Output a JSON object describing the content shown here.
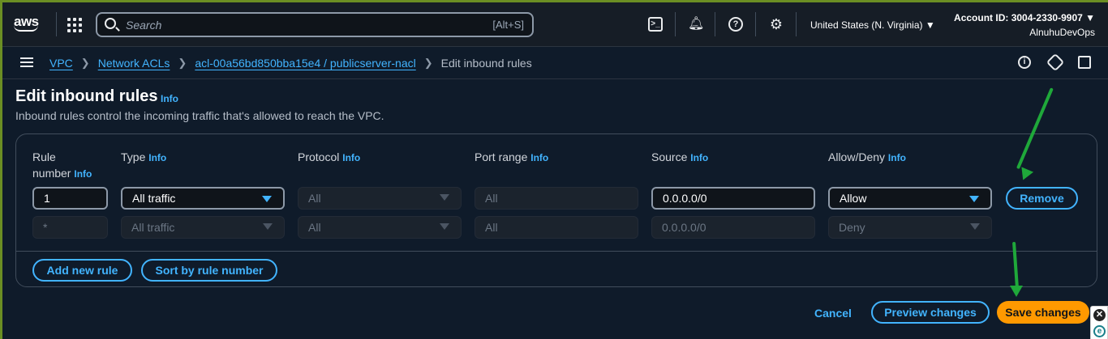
{
  "topnav": {
    "logo": "aws",
    "search_placeholder": "Search",
    "search_shortcut": "[Alt+S]",
    "region": "United States (N. Virginia) ▼",
    "account_id": "Account ID: 3004-2330-9907 ▼",
    "account_name": "AlnuhuDevOps",
    "icons": [
      "services-grid-icon",
      "search-icon",
      "cloudshell-icon",
      "notifications-bell-icon",
      "help-icon",
      "settings-gear-icon"
    ]
  },
  "breadcrumb": {
    "items": [
      "VPC",
      "Network ACLs",
      "acl-00a56bd850bba15e4 / publicserver-nacl"
    ],
    "current": "Edit inbound rules"
  },
  "page": {
    "title": "Edit inbound rules",
    "info": "Info",
    "description": "Inbound rules control the incoming traffic that's allowed to reach the VPC."
  },
  "table": {
    "headers": {
      "rule_number_line1": "Rule",
      "rule_number_line2": "number",
      "type": "Type",
      "protocol": "Protocol",
      "port_range": "Port range",
      "source": "Source",
      "allow_deny": "Allow/Deny",
      "info": "Info"
    },
    "rows": [
      {
        "rule_number": "1",
        "type": "All traffic",
        "protocol": "All",
        "port_range": "All",
        "source": "0.0.0.0/0",
        "allow_deny": "Allow",
        "action": "Remove"
      },
      {
        "rule_number": "*",
        "type": "All traffic",
        "protocol": "All",
        "port_range": "All",
        "source": "0.0.0.0/0",
        "allow_deny": "Deny"
      }
    ],
    "add_rule": "Add new rule",
    "sort_rule": "Sort by rule number"
  },
  "footer": {
    "cancel": "Cancel",
    "preview": "Preview changes",
    "save": "Save changes"
  },
  "annotation_color": "#1fa83a",
  "accent_color": "#42b4ff",
  "primary_color": "#ff9900"
}
